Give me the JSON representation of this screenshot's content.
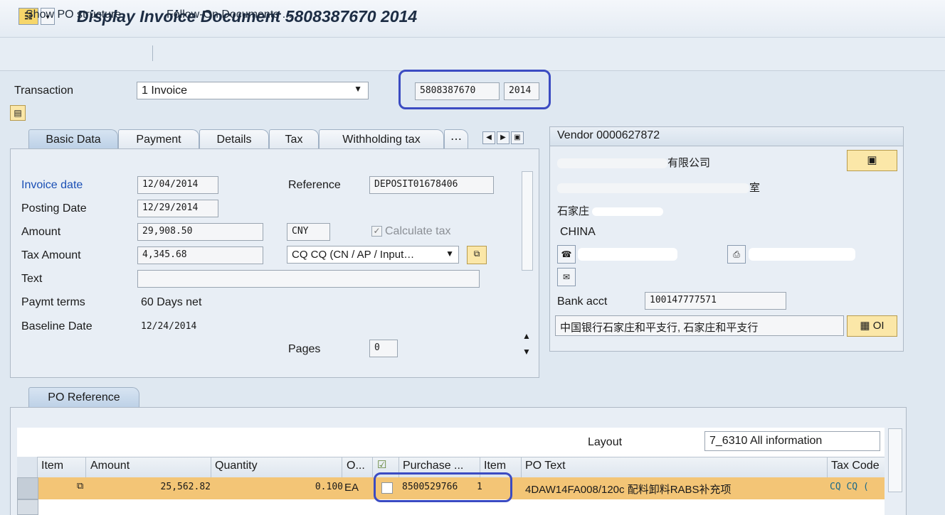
{
  "window": {
    "title": "Display Invoice Document 5808387670 2014"
  },
  "toolbar": {
    "show_po_structure": "Show PO structure",
    "follow_on_documents": "Follow-On Documents ..."
  },
  "header": {
    "transaction_label": "Transaction",
    "transaction_value": "1 Invoice",
    "document_number": "5808387670",
    "fiscal_year": "2014"
  },
  "tabs": [
    "Basic Data",
    "Payment",
    "Details",
    "Tax",
    "Withholding tax"
  ],
  "basic_data": {
    "invoice_date_label": "Invoice date",
    "invoice_date": "12/04/2014",
    "posting_date_label": "Posting Date",
    "posting_date": "12/29/2014",
    "amount_label": "Amount",
    "amount": "29,908.50",
    "currency": "CNY",
    "calculate_tax_label": "Calculate tax",
    "calculate_tax_checked": true,
    "tax_amount_label": "Tax Amount",
    "tax_amount": "4,345.68",
    "tax_code": "CQ CQ (CN / AP / Input…",
    "text_label": "Text",
    "text_value": "",
    "reference_label": "Reference",
    "reference": "DEPOSIT01678406",
    "paymt_terms_label": "Paymt terms",
    "paymt_terms": "60 Days net",
    "baseline_date_label": "Baseline Date",
    "baseline_date": "12/24/2014",
    "pages_label": "Pages",
    "pages": "0"
  },
  "vendor": {
    "title": "Vendor 0000627872",
    "name": "有限公司",
    "street": "室",
    "city": "石家庄",
    "country": "CHINA",
    "bank_acct_label": "Bank acct",
    "bank_acct": "100147777571",
    "bank_name": "中国银行石家庄和平支行, 石家庄和平支行",
    "oi_button": "OI"
  },
  "po_reference": {
    "tab_label": "PO Reference",
    "layout_label": "Layout",
    "layout_value": "7_6310 All information",
    "columns": [
      "Item",
      "Amount",
      "Quantity",
      "O...",
      "Purchase ...",
      "Item",
      "PO Text",
      "Tax Code"
    ],
    "rows": [
      {
        "amount": "25,562.82",
        "quantity": "0.100",
        "unit": "EA",
        "purchase_order": "8500529766",
        "item": "1",
        "po_text": "4DAW14FA008/120c 配料卸料RABS补充项",
        "tax_code": "CQ CQ ("
      }
    ]
  },
  "colors": {
    "background": "#dfe8f1",
    "highlight": "#3b4bc2",
    "selected_row": "#f3c576",
    "link_label": "#1a4fb5"
  }
}
